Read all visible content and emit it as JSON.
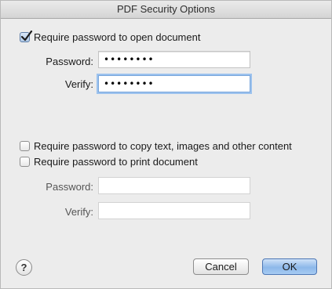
{
  "dialog": {
    "title": "PDF Security Options"
  },
  "open_section": {
    "checkbox_label": "Require password to open document",
    "checked": true,
    "password_label": "Password:",
    "password_value": "••••••••",
    "verify_label": "Verify:",
    "verify_value": "••••••••"
  },
  "permissions_section": {
    "copy_label": "Require password to copy text, images and other content",
    "copy_checked": false,
    "print_label": "Require password to print document",
    "print_checked": false,
    "password_label": "Password:",
    "password_value": "",
    "verify_label": "Verify:",
    "verify_value": ""
  },
  "footer": {
    "help_label": "?",
    "cancel_label": "Cancel",
    "ok_label": "OK"
  },
  "colors": {
    "background": "#ececec",
    "focus_ring": "#9cc2ee",
    "default_button": "#8db8ea"
  },
  "icons": {
    "checkmark": "checkmark-icon",
    "help": "question-mark-icon"
  }
}
